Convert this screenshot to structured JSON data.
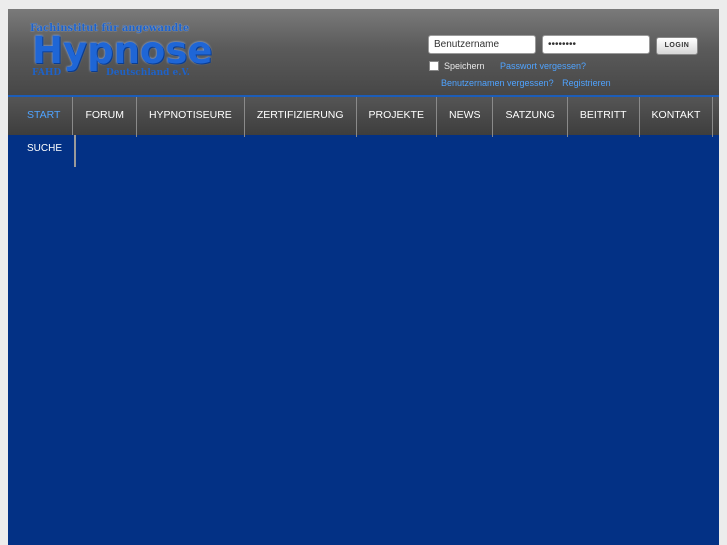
{
  "logo": {
    "tagline": "Fachinstitut für angewandte",
    "word": "Hypnose",
    "abbr": "FAHD",
    "country": "Deutschland e.V."
  },
  "login": {
    "username_value": "Benutzername",
    "password_value": "••••••••",
    "login_label": "LOGIN",
    "remember_label": "Speichern",
    "forgot_password": "Passwort vergessen?",
    "forgot_username": "Benutzernamen vergessen?",
    "register": "Registrieren"
  },
  "nav": {
    "items": [
      {
        "label": "START"
      },
      {
        "label": "FORUM"
      },
      {
        "label": "HYPNOTISEURE"
      },
      {
        "label": "ZERTIFIZIERUNG"
      },
      {
        "label": "PROJEKTE"
      },
      {
        "label": "NEWS"
      },
      {
        "label": "SATZUNG"
      },
      {
        "label": "BEITRITT"
      },
      {
        "label": "KONTAKT"
      }
    ],
    "row2": [
      {
        "label": "SUCHE"
      }
    ]
  },
  "colors": {
    "accent": "#4fa3ff",
    "background": "#033185"
  }
}
